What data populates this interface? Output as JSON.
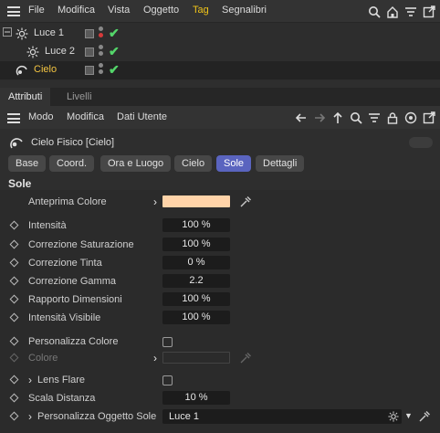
{
  "menu": {
    "items": [
      "File",
      "Modifica",
      "Vista",
      "Oggetto",
      "Tag",
      "Segnalibri"
    ]
  },
  "tree": {
    "rows": [
      {
        "label": "Luce 1"
      },
      {
        "label": "Luce 2"
      },
      {
        "label": "Cielo"
      }
    ]
  },
  "tabs": {
    "attributi": "Attributi",
    "livelli": "Livelli"
  },
  "attr_menu": {
    "modo": "Modo",
    "modifica": "Modifica",
    "dati_utente": "Dati Utente"
  },
  "object": {
    "title": "Cielo Fisico [Cielo]"
  },
  "section_tabs": [
    "Base",
    "Coord.",
    "Ora e Luogo",
    "Cielo",
    "Sole",
    "Dettagli"
  ],
  "section": {
    "title": "Sole"
  },
  "params": {
    "anteprima_colore": "Anteprima Colore",
    "intensita": {
      "label": "Intensità",
      "value": "100 %"
    },
    "corr_saturazione": {
      "label": "Correzione Saturazione",
      "value": "100 %"
    },
    "corr_tinta": {
      "label": "Correzione Tinta",
      "value": "0 %"
    },
    "corr_gamma": {
      "label": "Correzione Gamma",
      "value": "2.2"
    },
    "rapporto_dim": {
      "label": "Rapporto Dimensioni",
      "value": "100 %"
    },
    "intensita_visibile": {
      "label": "Intensità Visibile",
      "value": "100 %"
    },
    "personalizza_colore": "Personalizza Colore",
    "colore": "Colore",
    "lens_flare": "Lens Flare",
    "scala_distanza": {
      "label": "Scala Distanza",
      "value": "10 %"
    },
    "personalizza_oggetto_sole": {
      "label": "Personalizza Oggetto Sole",
      "value": "Luce 1"
    }
  },
  "colors": {
    "accent": "#5a64bf",
    "tag": "#f0c419",
    "check": "#54d66a",
    "preview": "#ffd3a8"
  }
}
